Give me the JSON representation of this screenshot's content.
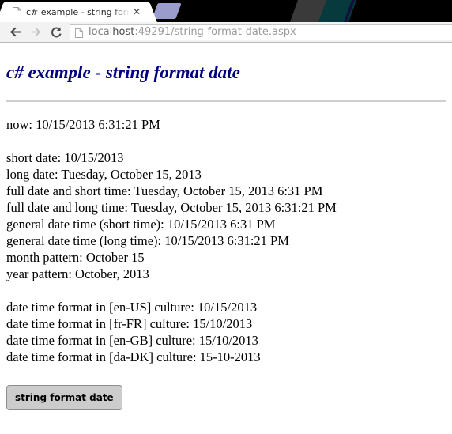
{
  "browser": {
    "tab": {
      "title": "c# example - string forma",
      "favicon_icon": "document-icon",
      "close_icon": "close-icon"
    },
    "nav": {
      "back_icon": "arrow-left-icon",
      "forward_icon": "arrow-right-icon",
      "reload_icon": "reload-icon"
    },
    "omnibox": {
      "favicon_icon": "document-icon",
      "url_host_prefix": "local",
      "url_host_strong": "host",
      "url_rest": ":49291/string-format-date.aspx",
      "url_full": "localhost:49291/string-format-date.aspx"
    },
    "colors": {
      "tabstrip_bg": "#000000",
      "deco_purple": "#9a9ccd",
      "deco_gray": "#3a3a3a",
      "deco_teal": "#063a3d",
      "toolbar_bg": "#f2f2f2"
    }
  },
  "page": {
    "title": "c# example - string format date",
    "title_color": "#000080",
    "now_line": "now: 10/15/2013 6:31:21 PM",
    "format_lines": [
      "short date: 10/15/2013",
      "long date: Tuesday, October 15, 2013",
      "full date and short time: Tuesday, October 15, 2013 6:31 PM",
      "full date and long time: Tuesday, October 15, 2013 6:31:21 PM",
      "general date time (short time): 10/15/2013 6:31 PM",
      "general date time (long time): 10/15/2013 6:31:21 PM",
      "month pattern: October 15",
      "year pattern: October, 2013"
    ],
    "culture_lines": [
      "date time format in [en-US] culture: 10/15/2013",
      "date time format in [fr-FR] culture: 15/10/2013",
      "date time format in [en-GB] culture: 15/10/2013",
      "date time format in [da-DK] culture: 15-10-2013"
    ],
    "button_label": "string format date"
  }
}
